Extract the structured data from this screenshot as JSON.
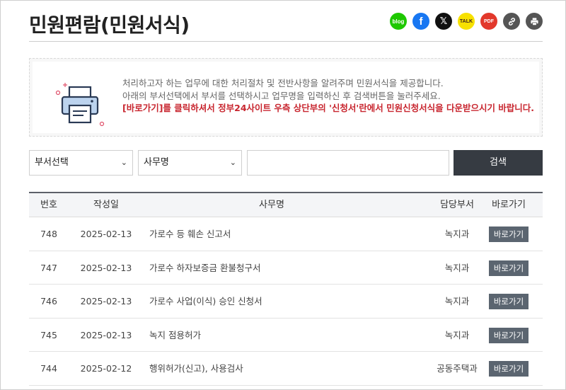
{
  "header": {
    "title": "민원편람(민원서식)",
    "share": [
      {
        "icon": "blog-icon",
        "label": "blog",
        "color": "#1ec800"
      },
      {
        "icon": "facebook-icon",
        "label": "f",
        "color": "#1877f2"
      },
      {
        "icon": "x-icon",
        "label": "𝕏",
        "color": "#111111"
      },
      {
        "icon": "kakao-talk-icon",
        "label": "TALK",
        "color": "#f7e100"
      },
      {
        "icon": "pdf-icon",
        "label": "PDF",
        "color": "#e2382b"
      },
      {
        "icon": "link-icon",
        "label": "🔗",
        "color": "#555555"
      },
      {
        "icon": "print-icon",
        "label": "⎙",
        "color": "#555555"
      }
    ]
  },
  "info": {
    "line1": "처리하고자 하는 업무에 대한 처리절차 및 전반사항을 알려주며 민원서식을 제공합니다.",
    "line2": "아래의 부서선택에서 부서를 선택하시고 업무명을 입력하신 후 검색버튼을 눌러주세요.",
    "line3": "[바로가기]를 클릭하셔서 정부24사이트 우측 상단부의 '신청서'란에서 민원신청서식을 다운받으시기 바랍니다.",
    "icon": "printer-icon"
  },
  "search": {
    "dept_select": "부서선택",
    "task_select": "사무명",
    "input_value": "",
    "button": "검색"
  },
  "table": {
    "headers": {
      "no": "번호",
      "date": "작성일",
      "name": "사무명",
      "dept": "담당부서",
      "go": "바로가기"
    },
    "rows": [
      {
        "no": "748",
        "date": "2025-02-13",
        "name": "가로수 등 훼손 신고서",
        "dept": "녹지과",
        "go": "바로가기"
      },
      {
        "no": "747",
        "date": "2025-02-13",
        "name": "가로수 하자보증금 환불청구서",
        "dept": "녹지과",
        "go": "바로가기"
      },
      {
        "no": "746",
        "date": "2025-02-13",
        "name": "가로수 사업(이식) 승인 신청서",
        "dept": "녹지과",
        "go": "바로가기"
      },
      {
        "no": "745",
        "date": "2025-02-13",
        "name": "녹지 점용허가",
        "dept": "녹지과",
        "go": "바로가기"
      },
      {
        "no": "744",
        "date": "2025-02-12",
        "name": "행위허가(신고), 사용검사",
        "dept": "공동주택과",
        "go": "바로가기"
      }
    ]
  }
}
